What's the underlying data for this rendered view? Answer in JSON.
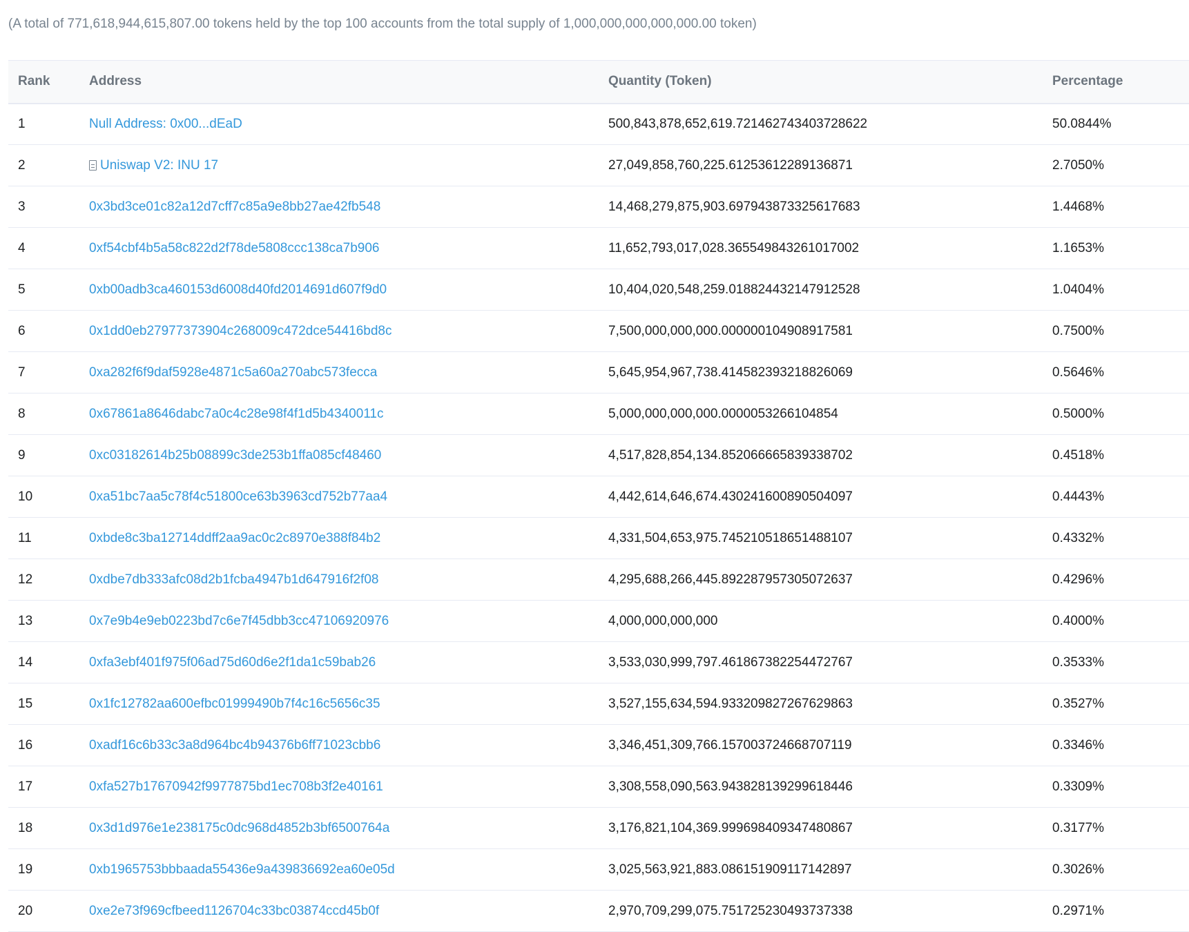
{
  "summary": "(A total of 771,618,944,615,807.00 tokens held by the top 100 accounts from the total supply of 1,000,000,000,000,000.00 token)",
  "table": {
    "headers": {
      "rank": "Rank",
      "address": "Address",
      "quantity": "Quantity (Token)",
      "percentage": "Percentage"
    },
    "rows": [
      {
        "rank": "1",
        "address": "Null Address: 0x00...dEaD",
        "is_contract": false,
        "quantity": "500,843,878,652,619.721462743403728622",
        "percentage": "50.0844%"
      },
      {
        "rank": "2",
        "address": "Uniswap V2: INU 17",
        "is_contract": true,
        "quantity": "27,049,858,760,225.61253612289136871",
        "percentage": "2.7050%"
      },
      {
        "rank": "3",
        "address": "0x3bd3ce01c82a12d7cff7c85a9e8bb27ae42fb548",
        "is_contract": false,
        "quantity": "14,468,279,875,903.697943873325617683",
        "percentage": "1.4468%"
      },
      {
        "rank": "4",
        "address": "0xf54cbf4b5a58c822d2f78de5808ccc138ca7b906",
        "is_contract": false,
        "quantity": "11,652,793,017,028.365549843261017002",
        "percentage": "1.1653%"
      },
      {
        "rank": "5",
        "address": "0xb00adb3ca460153d6008d40fd2014691d607f9d0",
        "is_contract": false,
        "quantity": "10,404,020,548,259.018824432147912528",
        "percentage": "1.0404%"
      },
      {
        "rank": "6",
        "address": "0x1dd0eb27977373904c268009c472dce54416bd8c",
        "is_contract": false,
        "quantity": "7,500,000,000,000.000000104908917581",
        "percentage": "0.7500%"
      },
      {
        "rank": "7",
        "address": "0xa282f6f9daf5928e4871c5a60a270abc573fecca",
        "is_contract": false,
        "quantity": "5,645,954,967,738.414582393218826069",
        "percentage": "0.5646%"
      },
      {
        "rank": "8",
        "address": "0x67861a8646dabc7a0c4c28e98f4f1d5b4340011c",
        "is_contract": false,
        "quantity": "5,000,000,000,000.0000053266104854",
        "percentage": "0.5000%"
      },
      {
        "rank": "9",
        "address": "0xc03182614b25b08899c3de253b1ffa085cf48460",
        "is_contract": false,
        "quantity": "4,517,828,854,134.852066665839338702",
        "percentage": "0.4518%"
      },
      {
        "rank": "10",
        "address": "0xa51bc7aa5c78f4c51800ce63b3963cd752b77aa4",
        "is_contract": false,
        "quantity": "4,442,614,646,674.430241600890504097",
        "percentage": "0.4443%"
      },
      {
        "rank": "11",
        "address": "0xbde8c3ba12714ddff2aa9ac0c2c8970e388f84b2",
        "is_contract": false,
        "quantity": "4,331,504,653,975.745210518651488107",
        "percentage": "0.4332%"
      },
      {
        "rank": "12",
        "address": "0xdbe7db333afc08d2b1fcba4947b1d647916f2f08",
        "is_contract": false,
        "quantity": "4,295,688,266,445.892287957305072637",
        "percentage": "0.4296%"
      },
      {
        "rank": "13",
        "address": "0x7e9b4e9eb0223bd7c6e7f45dbb3cc47106920976",
        "is_contract": false,
        "quantity": "4,000,000,000,000",
        "percentage": "0.4000%"
      },
      {
        "rank": "14",
        "address": "0xfa3ebf401f975f06ad75d60d6e2f1da1c59bab26",
        "is_contract": false,
        "quantity": "3,533,030,999,797.461867382254472767",
        "percentage": "0.3533%"
      },
      {
        "rank": "15",
        "address": "0x1fc12782aa600efbc01999490b7f4c16c5656c35",
        "is_contract": false,
        "quantity": "3,527,155,634,594.933209827267629863",
        "percentage": "0.3527%"
      },
      {
        "rank": "16",
        "address": "0xadf16c6b33c3a8d964bc4b94376b6ff71023cbb6",
        "is_contract": false,
        "quantity": "3,346,451,309,766.157003724668707119",
        "percentage": "0.3346%"
      },
      {
        "rank": "17",
        "address": "0xfa527b17670942f9977875bd1ec708b3f2e40161",
        "is_contract": false,
        "quantity": "3,308,558,090,563.943828139299618446",
        "percentage": "0.3309%"
      },
      {
        "rank": "18",
        "address": "0x3d1d976e1e238175c0dc968d4852b3bf6500764a",
        "is_contract": false,
        "quantity": "3,176,821,104,369.999698409347480867",
        "percentage": "0.3177%"
      },
      {
        "rank": "19",
        "address": "0xb1965753bbbaada55436e9a439836692ea60e05d",
        "is_contract": false,
        "quantity": "3,025,563,921,883.086151909117142897",
        "percentage": "0.3026%"
      },
      {
        "rank": "20",
        "address": "0xe2e73f969cfbeed1126704c33bc03874ccd45b0f",
        "is_contract": false,
        "quantity": "2,970,709,299,075.751725230493737338",
        "percentage": "0.2971%"
      }
    ]
  },
  "colors": {
    "link": "#3498db",
    "muted_text": "#77838f",
    "header_bg": "#f8f9fa",
    "border": "#e7eaf3"
  },
  "icons": {
    "contract": "file-text-icon"
  }
}
